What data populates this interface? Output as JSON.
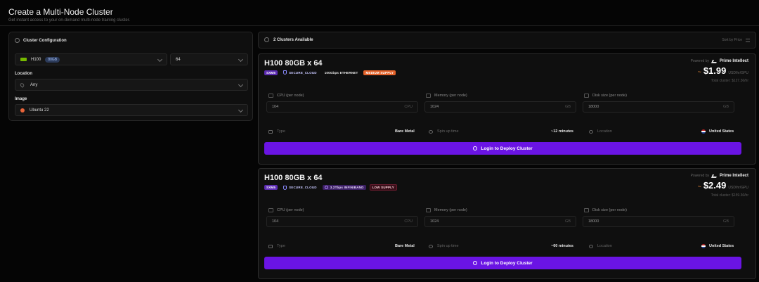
{
  "page": {
    "title": "Create a Multi-Node Cluster",
    "subtitle": "Get instant access to your on-demand multi-node training cluster."
  },
  "config": {
    "header": "Cluster Configuration",
    "gpu": {
      "name": "H100",
      "badge": "80GB"
    },
    "gpu_count": "64",
    "location_label": "Location",
    "location_value": "Any",
    "image_label": "Image",
    "image_value": "Ubuntu 22"
  },
  "results": {
    "count_label": "2 Clusters Available",
    "sort_label": "Sort by Price"
  },
  "cards": [
    {
      "title": "H100 80GB x 64",
      "tags": {
        "form": "SXM5",
        "cloud": "SECURE_CLOUD",
        "network": "100Gbps ETHERNET",
        "supply": "MEDIUM SUPPLY"
      },
      "provider_prefix": "Powered by",
      "provider": "Prime Intellect",
      "price": "$1.99",
      "price_unit": "USD/hr/GPU",
      "total": "Total cluster: $127.36/hr",
      "cpu_label": "CPU (per node)",
      "cpu_value": "104",
      "cpu_unit": "CPU",
      "mem_label": "Memory (per node)",
      "mem_value": "1024",
      "mem_unit": "GB",
      "disk_label": "Disk size (per node)",
      "disk_value": "18000",
      "disk_unit": "GB",
      "type_label": "Type",
      "type_value": "Bare Metal",
      "spin_label": "Spin up time",
      "spin_value": "~12 minutes",
      "loc_label": "Location",
      "loc_value": "United States",
      "button": "Login to Deploy Cluster"
    },
    {
      "title": "H100 80GB x 64",
      "tags": {
        "form": "SXM5",
        "cloud": "SECURE_CLOUD",
        "network": "3.2Tbps INFINIBAND",
        "supply": "LOW SUPPLY"
      },
      "provider_prefix": "Powered by",
      "provider": "Prime Intellect",
      "price": "$2.49",
      "price_unit": "USD/hr/GPU",
      "total": "Total cluster: $159.36/hr",
      "cpu_label": "CPU (per node)",
      "cpu_value": "104",
      "cpu_unit": "CPU",
      "mem_label": "Memory (per node)",
      "mem_value": "1024",
      "mem_unit": "GB",
      "disk_label": "Disk size (per node)",
      "disk_value": "18000",
      "disk_unit": "GB",
      "type_label": "Type",
      "type_value": "Bare Metal",
      "spin_label": "Spin up time",
      "spin_value": "~60 minutes",
      "loc_label": "Location",
      "loc_value": "United States",
      "button": "Login to Deploy Cluster"
    }
  ]
}
